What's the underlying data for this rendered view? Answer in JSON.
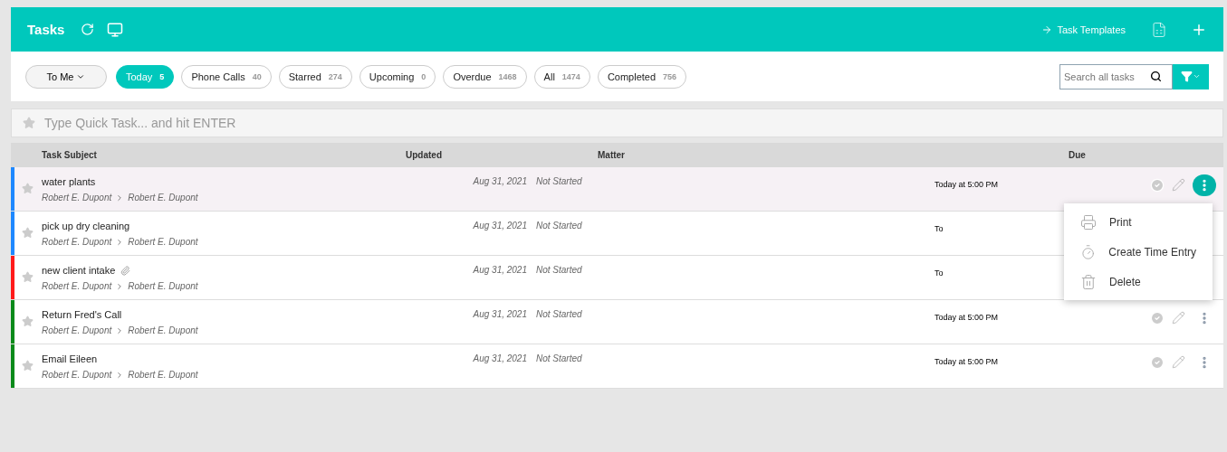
{
  "header": {
    "title": "Tasks",
    "templates_link": "Task Templates"
  },
  "filters": {
    "assignee": "To Me",
    "chips": [
      {
        "label": "Today",
        "count": "5",
        "selected": true
      },
      {
        "label": "Phone Calls",
        "count": "40",
        "selected": false
      },
      {
        "label": "Starred",
        "count": "274",
        "selected": false
      },
      {
        "label": "Upcoming",
        "count": "0",
        "selected": false
      },
      {
        "label": "Overdue",
        "count": "1468",
        "selected": false
      },
      {
        "label": "All",
        "count": "1474",
        "selected": false
      },
      {
        "label": "Completed",
        "count": "756",
        "selected": false
      }
    ],
    "search": {
      "placeholder": "Search all tasks"
    }
  },
  "quick_task": {
    "placeholder": "Type Quick Task... and hit ENTER"
  },
  "table": {
    "columns": [
      "Task Subject",
      "Updated",
      "Matter",
      "Due"
    ],
    "rows": [
      {
        "subject": "water plants",
        "from": "Robert E. Dupont",
        "to": "Robert E. Dupont",
        "updated": "Aug 31, 2021",
        "status": "Not Started",
        "due": "Today at 5:00 PM",
        "color": "#1e88ff",
        "attachment": false,
        "selected": true,
        "actions_visible": true,
        "menu_open": true
      },
      {
        "subject": "pick up dry cleaning",
        "from": "Robert E. Dupont",
        "to": "Robert E. Dupont",
        "updated": "Aug 31, 2021",
        "status": "Not Started",
        "due": "To",
        "color": "#1e88ff",
        "attachment": false,
        "selected": false,
        "actions_visible": false,
        "menu_open": false
      },
      {
        "subject": "new client intake",
        "from": "Robert E. Dupont",
        "to": "Robert E. Dupont",
        "updated": "Aug 31, 2021",
        "status": "Not Started",
        "due": "To",
        "color": "#ff1a1a",
        "attachment": true,
        "selected": false,
        "actions_visible": false,
        "menu_open": false
      },
      {
        "subject": "Return Fred's Call",
        "from": "Robert E. Dupont",
        "to": "Robert E. Dupont",
        "updated": "Aug 31, 2021",
        "status": "Not Started",
        "due": "Today at 5:00 PM",
        "color": "#0a8a1a",
        "attachment": false,
        "selected": false,
        "actions_visible": true,
        "menu_open": false
      },
      {
        "subject": "Email Eileen",
        "from": "Robert E. Dupont",
        "to": "Robert E. Dupont",
        "updated": "Aug 31, 2021",
        "status": "Not Started",
        "due": "Today at 5:00 PM",
        "color": "#0a8a1a",
        "attachment": false,
        "selected": false,
        "actions_visible": true,
        "menu_open": false
      }
    ]
  },
  "row_menu": {
    "items": [
      {
        "kind": "print",
        "label": "Print"
      },
      {
        "kind": "time",
        "label": "Create Time Entry"
      },
      {
        "kind": "delete",
        "label": "Delete"
      }
    ]
  }
}
